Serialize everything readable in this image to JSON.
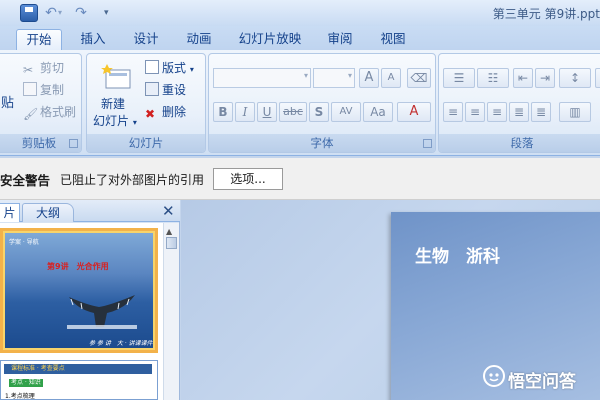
{
  "window": {
    "doc_title": "第三单元 第9讲.ppt"
  },
  "quick_access": {
    "more_label": "▾"
  },
  "tabs": [
    {
      "label": "开始",
      "active": true
    },
    {
      "label": "插入"
    },
    {
      "label": "设计"
    },
    {
      "label": "动画"
    },
    {
      "label": "幻灯片放映"
    },
    {
      "label": "审阅"
    },
    {
      "label": "视图"
    }
  ],
  "ribbon": {
    "clipboard": {
      "paste": "贴",
      "cut": "剪切",
      "copy": "复制",
      "format_painter": "格式刷",
      "label": "剪贴板"
    },
    "slides": {
      "new_slide_line1": "新建",
      "new_slide_line2": "幻灯片",
      "layout": "版式",
      "reset": "重设",
      "delete": "删除",
      "label": "幻灯片"
    },
    "font": {
      "grow": "A",
      "shrink": "A",
      "bold": "B",
      "italic": "I",
      "underline": "U",
      "strike": "abc",
      "shadow": "S",
      "spacing": "AV",
      "case": "Aa",
      "color": "A",
      "label": "字体"
    },
    "paragraph": {
      "label": "段落"
    }
  },
  "security_bar": {
    "title": "安全警告",
    "message": "已阻止了对外部图片的引用",
    "options_button": "选项..."
  },
  "left_pane": {
    "tab_slides": "片",
    "tab_outline": "大纲",
    "close": "✕",
    "thumb1": {
      "tag": "学案 · 导航",
      "title": "第9讲　光合作用",
      "footer": "参 参 讲　大 · 讲课课件"
    },
    "thumb2": {
      "header": "课程标准 · 考查要点",
      "chip": "考点 · 知识",
      "sub": "1.考点梳理"
    }
  },
  "slide": {
    "heading": "生物　浙科"
  },
  "watermark": {
    "text": "悟空问答"
  },
  "colors": {
    "ribbon_text": "#15428b",
    "accent_orange": "#f3b24a",
    "slide_blue": "#6f93c8"
  }
}
